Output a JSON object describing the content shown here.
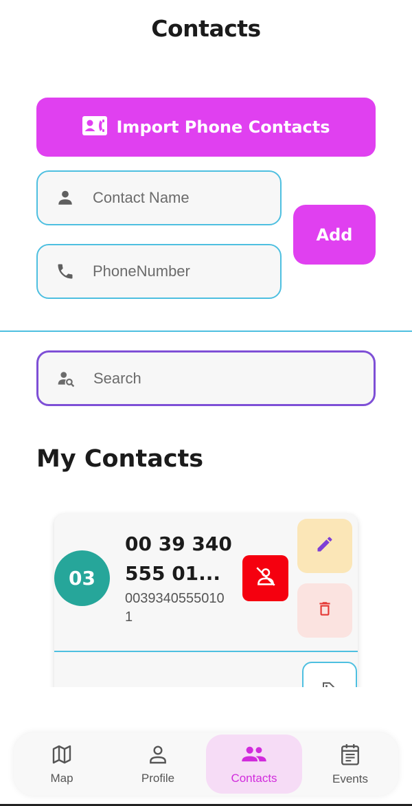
{
  "header": {
    "title": "Contacts"
  },
  "import": {
    "label": "Import Phone Contacts",
    "icon": "contacts-icon"
  },
  "form": {
    "name_placeholder": "Contact Name",
    "name_icon": "person-icon",
    "phone_placeholder": "PhoneNumber",
    "phone_icon": "phone-icon",
    "add_label": "Add"
  },
  "search": {
    "placeholder": "Search",
    "icon": "person-search-icon"
  },
  "section": {
    "title": "My Contacts"
  },
  "contacts": [
    {
      "avatar_text": "03",
      "name_line1": "00 39 340",
      "name_line2": "555 01...",
      "phone": "00393405550101"
    }
  ],
  "nav": {
    "items": [
      {
        "label": "Map",
        "icon": "map-icon",
        "active": false
      },
      {
        "label": "Profile",
        "icon": "profile-icon",
        "active": false
      },
      {
        "label": "Contacts",
        "icon": "group-icon",
        "active": true
      },
      {
        "label": "Events",
        "icon": "events-icon",
        "active": false
      }
    ]
  },
  "colors": {
    "accent": "#e040f0",
    "field_border": "#4dbfe0",
    "search_border": "#7e4fd6",
    "avatar": "#26a69a",
    "block": "#f5000f",
    "edit_bg": "#fbe6b7",
    "delete_bg": "#fbe3e0"
  }
}
